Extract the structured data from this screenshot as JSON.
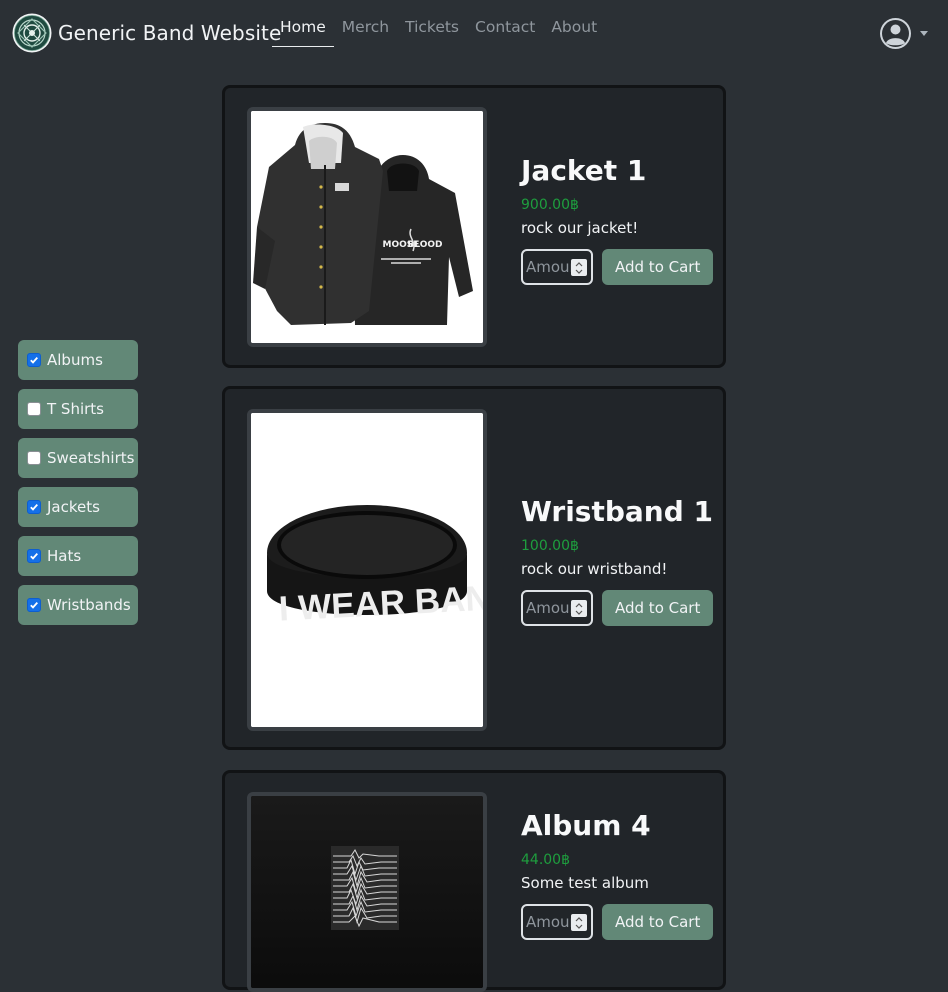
{
  "brand": {
    "name": "Generic Band Website"
  },
  "nav": {
    "links": [
      {
        "label": "Home",
        "active": true
      },
      {
        "label": "Merch"
      },
      {
        "label": "Tickets"
      },
      {
        "label": "Contact"
      },
      {
        "label": "About"
      }
    ]
  },
  "filters": [
    {
      "label": "Albums",
      "checked": true
    },
    {
      "label": "T Shirts",
      "checked": false
    },
    {
      "label": "Sweatshirts",
      "checked": false
    },
    {
      "label": "Jackets",
      "checked": true
    },
    {
      "label": "Hats",
      "checked": true
    },
    {
      "label": "Wristbands",
      "checked": true
    }
  ],
  "products": [
    {
      "title": "Jacket 1",
      "price": "900.00฿",
      "description": "rock our jacket!",
      "qty_placeholder": "Amount",
      "button": "Add to Cart",
      "image": "black-jacket"
    },
    {
      "title": "Wristband 1",
      "price": "100.00฿",
      "description": "rock our wristband!",
      "qty_placeholder": "Amount",
      "button": "Add to Cart",
      "image": "black-wristband",
      "wristband_text": "I WEAR BAND M"
    },
    {
      "title": "Album 4",
      "price": "44.00฿",
      "description": "Some test album",
      "qty_placeholder": "Amount",
      "button": "Add to Cart",
      "image": "album-cover"
    }
  ],
  "jacket_prints": [
    "MOOSE",
    "BLOOD"
  ],
  "colors": {
    "accent": "#628877",
    "price": "#1e9e3e",
    "card_bg": "#212529",
    "page_bg": "#2b3035"
  }
}
